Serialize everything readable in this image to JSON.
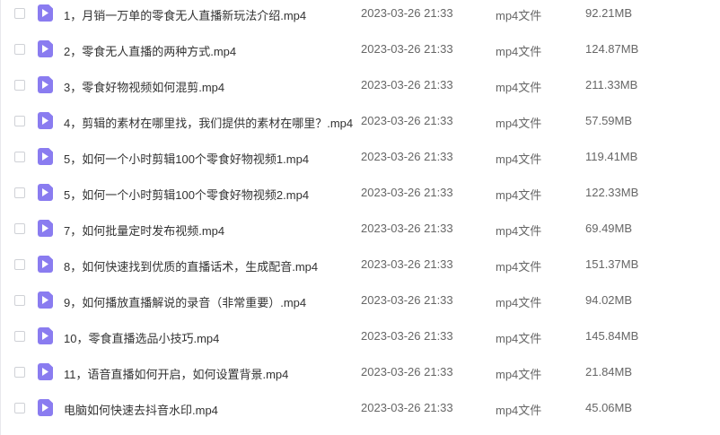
{
  "accent_color": "#8a7cf0",
  "file_icon": "video-file-icon",
  "files": [
    {
      "name": "1，月销一万单的零食无人直播新玩法介绍.mp4",
      "date": "2023-03-26 21:33",
      "type": "mp4文件",
      "size": "92.21MB"
    },
    {
      "name": "2，零食无人直播的两种方式.mp4",
      "date": "2023-03-26 21:33",
      "type": "mp4文件",
      "size": "124.87MB"
    },
    {
      "name": "3，零食好物视频如何混剪.mp4",
      "date": "2023-03-26 21:33",
      "type": "mp4文件",
      "size": "211.33MB"
    },
    {
      "name": "4，剪辑的素材在哪里找，我们提供的素材在哪里？.mp4",
      "date": "2023-03-26 21:33",
      "type": "mp4文件",
      "size": "57.59MB"
    },
    {
      "name": "5，如何一个小时剪辑100个零食好物视频1.mp4",
      "date": "2023-03-26 21:33",
      "type": "mp4文件",
      "size": "119.41MB"
    },
    {
      "name": "5，如何一个小时剪辑100个零食好物视频2.mp4",
      "date": "2023-03-26 21:33",
      "type": "mp4文件",
      "size": "122.33MB"
    },
    {
      "name": "7，如何批量定时发布视频.mp4",
      "date": "2023-03-26 21:33",
      "type": "mp4文件",
      "size": "69.49MB"
    },
    {
      "name": "8，如何快速找到优质的直播话术，生成配音.mp4",
      "date": "2023-03-26 21:33",
      "type": "mp4文件",
      "size": "151.37MB"
    },
    {
      "name": "9，如何播放直播解说的录音（非常重要）.mp4",
      "date": "2023-03-26 21:33",
      "type": "mp4文件",
      "size": "94.02MB"
    },
    {
      "name": "10，零食直播选品小技巧.mp4",
      "date": "2023-03-26 21:33",
      "type": "mp4文件",
      "size": "145.84MB"
    },
    {
      "name": "11，语音直播如何开启，如何设置背景.mp4",
      "date": "2023-03-26 21:33",
      "type": "mp4文件",
      "size": "21.84MB"
    },
    {
      "name": "电脑如何快速去抖音水印.mp4",
      "date": "2023-03-26 21:33",
      "type": "mp4文件",
      "size": "45.06MB"
    }
  ]
}
